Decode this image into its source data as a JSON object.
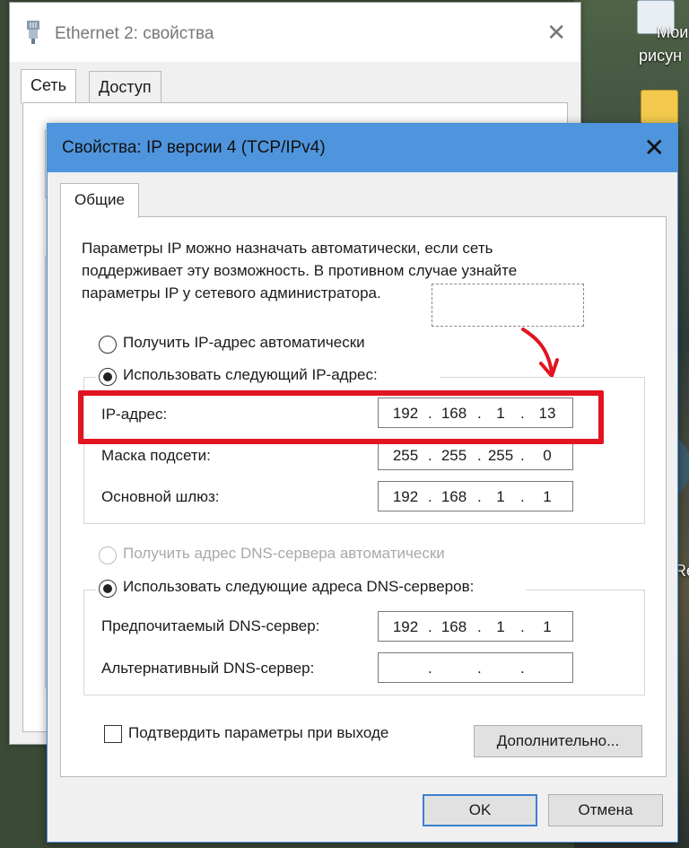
{
  "desktop": {
    "label_line1": "Мои",
    "label_line2": "рисун",
    "label_right": "Re"
  },
  "bg_window": {
    "title": "Ethernet 2: свойства",
    "tabs": [
      "Сеть",
      "Доступ"
    ]
  },
  "dialog": {
    "title": "Свойства: IP версии 4 (TCP/IPv4)",
    "tab": "Общие",
    "description": "Параметры IP можно назначать автоматически, если сеть поддерживает эту возможность. В противном случае узнайте параметры IP у сетевого администратора.",
    "ip_section": {
      "auto_label": "Получить IP-адрес автоматически",
      "manual_label": "Использовать следующий IP-адрес:",
      "selected": "manual",
      "fields": [
        {
          "label": "IP-адрес:",
          "octets": [
            "192",
            "168",
            "1",
            "13"
          ]
        },
        {
          "label": "Маска подсети:",
          "octets": [
            "255",
            "255",
            "255",
            "0"
          ]
        },
        {
          "label": "Основной шлюз:",
          "octets": [
            "192",
            "168",
            "1",
            "1"
          ]
        }
      ]
    },
    "dns_section": {
      "auto_label": "Получить адрес DNS-сервера автоматически",
      "manual_label": "Использовать следующие адреса DNS-серверов:",
      "selected": "manual",
      "fields": [
        {
          "label": "Предпочитаемый DNS-сервер:",
          "octets": [
            "192",
            "168",
            "1",
            "1"
          ]
        },
        {
          "label": "Альтернативный DNS-сервер:",
          "octets": [
            "",
            "",
            "",
            ""
          ]
        }
      ]
    },
    "validate_label": "Подтвердить параметры при выходе",
    "validate_checked": false,
    "advanced_button": "Дополнительно...",
    "ok_button": "OK",
    "cancel_button": "Отмена"
  },
  "colors": {
    "titlebar_active": "#4f95dd",
    "highlight": "#e2141f",
    "arrow": "#e2141f"
  }
}
